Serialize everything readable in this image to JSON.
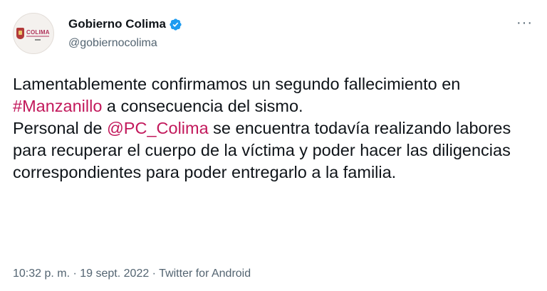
{
  "author": {
    "display_name": "Gobierno Colima",
    "handle": "@gobiernocolima",
    "avatar_text": "COLIMA",
    "verified_icon": "verified-badge-icon",
    "colors": {
      "verified": "#1d9bf0",
      "mention": "#c2185b",
      "secondary": "#536471"
    }
  },
  "menu": {
    "more_label": "···"
  },
  "tweet": {
    "line1_text": "Lamentablemente confirmamos un segundo fallecimiento en ",
    "hashtag": "#Manzanillo",
    "line1_rest": " a consecuencia del sismo.",
    "line2_text": "Personal de ",
    "mention": "@PC_Colima",
    "line2_rest": " se encuentra todavía realizando labores para recuperar el cuerpo de la víctima y poder hacer las diligencias correspondientes para poder entregarlo a la familia."
  },
  "meta": {
    "time": "10:32 p. m.",
    "sep1": " · ",
    "date": "19 sept. 2022",
    "sep2": " · ",
    "source": "Twitter for Android"
  }
}
